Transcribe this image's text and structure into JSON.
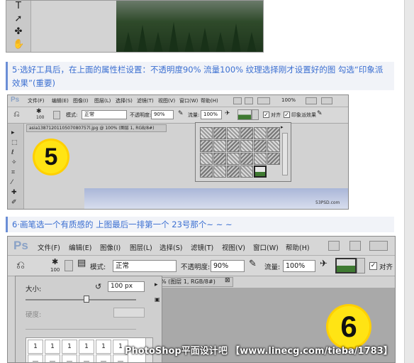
{
  "captions": {
    "step5": "5·选好工具后，在上面的属性栏设置：不透明度90% 流量100% 纹理选择刚才设置好的图 勾选“印象派效果”(重要)",
    "step6": "6·画笔选一个有质感的 上图最后一排第一个 23号那个~ ~ ~"
  },
  "step5": {
    "menu": [
      "文件(F)",
      "编辑(E)",
      "图像(I)",
      "图层(L)",
      "选择(S)",
      "滤镜(T)",
      "视图(V)",
      "窗口(W)",
      "帮助(H)"
    ],
    "zoom": "100%",
    "brush_size": "100",
    "mode_label": "模式:",
    "mode_value": "正常",
    "opacity_label": "不透明度:",
    "opacity_value": "90%",
    "flow_label": "流量:",
    "flow_value": "100%",
    "align_label": "对齐",
    "impressionist_label": "印象派效果",
    "doc_tab": "asia1387120110507080757l.jpg @ 100% (图层 1, RGB/8#)",
    "badge": "5",
    "site": "53PSD.com"
  },
  "step6": {
    "ps_logo": "Ps",
    "menu": [
      "文件(F)",
      "编辑(E)",
      "图像(I)",
      "图层(L)",
      "选择(S)",
      "滤镜(T)",
      "视图(V)",
      "窗口(W)",
      "帮助(H)"
    ],
    "brush_size": "100",
    "mode_label": "模式:",
    "mode_value": "正常",
    "opacity_label": "不透明度:",
    "opacity_value": "90%",
    "flow_label": "流量:",
    "flow_value": "100%",
    "align_label": "对齐",
    "size_label": "大小:",
    "size_value": "100 px",
    "hardness_label": "硬度:",
    "doc_tab": "% (图层 1, RGB/8#)",
    "badge": "6",
    "brush_row1": [
      "1",
      "1",
      "1",
      "1",
      "1",
      "1"
    ],
    "brush_row2": [
      "—",
      "—",
      "—",
      "—",
      "—",
      "—"
    ]
  },
  "watermark": "PhotoShop平面设计吧 【www.linecg.com/tieba/1783】",
  "colors": {
    "caption_text": "#3b6fd1",
    "caption_bar": "#6b8ed6",
    "badge": "#ffe414"
  }
}
